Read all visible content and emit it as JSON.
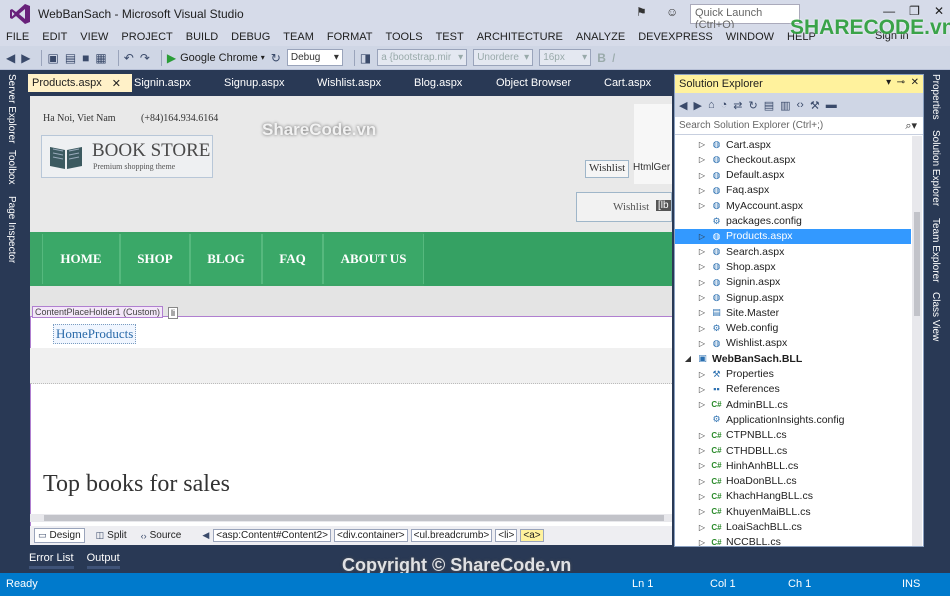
{
  "window": {
    "title": "WebBanSach - Microsoft Visual Studio",
    "quick_launch_placeholder": "Quick Launch (Ctrl+Q)",
    "sign_in": "Sign in",
    "controls": [
      "—",
      "❐",
      "✕"
    ]
  },
  "menu": [
    "FILE",
    "EDIT",
    "VIEW",
    "PROJECT",
    "BUILD",
    "DEBUG",
    "TEAM",
    "FORMAT",
    "TOOLS",
    "TEST",
    "ARCHITECTURE",
    "ANALYZE",
    "DEVEXPRESS",
    "WINDOW",
    "HELP"
  ],
  "toolbar": {
    "run_target": "Google Chrome",
    "config": "Debug",
    "css_class_placeholder": "a {bootstrap.mir",
    "list_style": "Unordere",
    "font_size": "16px",
    "bold": "B",
    "italic": "I"
  },
  "left_panels": [
    "Server Explorer",
    "Toolbox",
    "Page Inspector"
  ],
  "right_panels": [
    "Properties",
    "Solution Explorer",
    "Team Explorer",
    "Class View"
  ],
  "doc_tabs": [
    "Products.aspx",
    "Signin.aspx",
    "Signup.aspx",
    "Wishlist.aspx",
    "Blog.aspx",
    "Object Browser",
    "Cart.aspx"
  ],
  "site": {
    "location": "Ha Noi, Viet Nam",
    "phone": "(+84)164.934.6164",
    "brand_name": "BOOK STORE",
    "brand_tagline": "Premium shopping theme",
    "wishlist_link": "Wishlist",
    "html_generic_label": "HtmlGer",
    "wishlist_button": "Wishlist",
    "label_tag": "[lb",
    "nav": [
      "HOME",
      "SHOP",
      "BLOG",
      "FAQ",
      "ABOUT US"
    ],
    "placeholder_label": "ContentPlaceHolder1 (Custom)",
    "placeholder_glyph": "li",
    "breadcrumb": "HomeProducts",
    "section_title": "Top books for sales"
  },
  "view_bar": {
    "views": [
      "Design",
      "Split",
      "Source"
    ],
    "tag_path": [
      "<asp:Content#Content2>",
      "<div.container>",
      "<ul.breadcrumb>",
      "<li>",
      "<a>"
    ]
  },
  "bottom_tabs": [
    "Error List",
    "Output"
  ],
  "solution_explorer": {
    "title": "Solution Explorer",
    "search_placeholder": "Search Solution Explorer (Ctrl+;)",
    "items": [
      {
        "label": "Cart.aspx",
        "icon": "aspx-file-icon",
        "depth": 2,
        "expander": "▷"
      },
      {
        "label": "Checkout.aspx",
        "icon": "aspx-file-icon",
        "depth": 2,
        "expander": "▷"
      },
      {
        "label": "Default.aspx",
        "icon": "aspx-file-icon",
        "depth": 2,
        "expander": "▷"
      },
      {
        "label": "Faq.aspx",
        "icon": "aspx-file-icon",
        "depth": 2,
        "expander": "▷"
      },
      {
        "label": "MyAccount.aspx",
        "icon": "aspx-file-icon",
        "depth": 2,
        "expander": "▷"
      },
      {
        "label": "packages.config",
        "icon": "config-file-icon",
        "depth": 2,
        "expander": ""
      },
      {
        "label": "Products.aspx",
        "icon": "aspx-file-icon",
        "depth": 2,
        "expander": "▷",
        "selected": true
      },
      {
        "label": "Search.aspx",
        "icon": "aspx-file-icon",
        "depth": 2,
        "expander": "▷"
      },
      {
        "label": "Shop.aspx",
        "icon": "aspx-file-icon",
        "depth": 2,
        "expander": "▷"
      },
      {
        "label": "Signin.aspx",
        "icon": "aspx-file-icon",
        "depth": 2,
        "expander": "▷"
      },
      {
        "label": "Signup.aspx",
        "icon": "aspx-file-icon",
        "depth": 2,
        "expander": "▷"
      },
      {
        "label": "Site.Master",
        "icon": "master-file-icon",
        "depth": 2,
        "expander": "▷"
      },
      {
        "label": "Web.config",
        "icon": "config-file-icon",
        "depth": 2,
        "expander": "▷"
      },
      {
        "label": "Wishlist.aspx",
        "icon": "aspx-file-icon",
        "depth": 2,
        "expander": "▷"
      },
      {
        "label": "WebBanSach.BLL",
        "icon": "project-icon",
        "depth": 1,
        "expander": "◢",
        "bold": true
      },
      {
        "label": "Properties",
        "icon": "wrench-icon",
        "depth": 2,
        "expander": "▷"
      },
      {
        "label": "References",
        "icon": "references-icon",
        "depth": 2,
        "expander": "▷"
      },
      {
        "label": "AdminBLL.cs",
        "icon": "csharp-file-icon",
        "depth": 2,
        "expander": "▷"
      },
      {
        "label": "ApplicationInsights.config",
        "icon": "config-file-icon",
        "depth": 2,
        "expander": ""
      },
      {
        "label": "CTPNBLL.cs",
        "icon": "csharp-file-icon",
        "depth": 2,
        "expander": "▷"
      },
      {
        "label": "CTHDBLL.cs",
        "icon": "csharp-file-icon",
        "depth": 2,
        "expander": "▷"
      },
      {
        "label": "HinhAnhBLL.cs",
        "icon": "csharp-file-icon",
        "depth": 2,
        "expander": "▷"
      },
      {
        "label": "HoaDonBLL.cs",
        "icon": "csharp-file-icon",
        "depth": 2,
        "expander": "▷"
      },
      {
        "label": "KhachHangBLL.cs",
        "icon": "csharp-file-icon",
        "depth": 2,
        "expander": "▷"
      },
      {
        "label": "KhuyenMaiBLL.cs",
        "icon": "csharp-file-icon",
        "depth": 2,
        "expander": "▷"
      },
      {
        "label": "LoaiSachBLL.cs",
        "icon": "csharp-file-icon",
        "depth": 2,
        "expander": "▷"
      },
      {
        "label": "NCCBLL.cs",
        "icon": "csharp-file-icon",
        "depth": 2,
        "expander": "▷"
      }
    ]
  },
  "status": {
    "state": "Ready",
    "line": "Ln 1",
    "col": "Col 1",
    "ch": "Ch 1",
    "mode": "INS"
  },
  "watermarks": {
    "center": "ShareCode.vn",
    "logo": "SHARECODE.vn",
    "bottom": "Copyright © ShareCode.vn"
  },
  "colors": {
    "accent": "#007acc",
    "chrome": "#293955",
    "nav_green": "#3ba466",
    "selection": "#3399ff",
    "highlight": "#fff29d"
  }
}
